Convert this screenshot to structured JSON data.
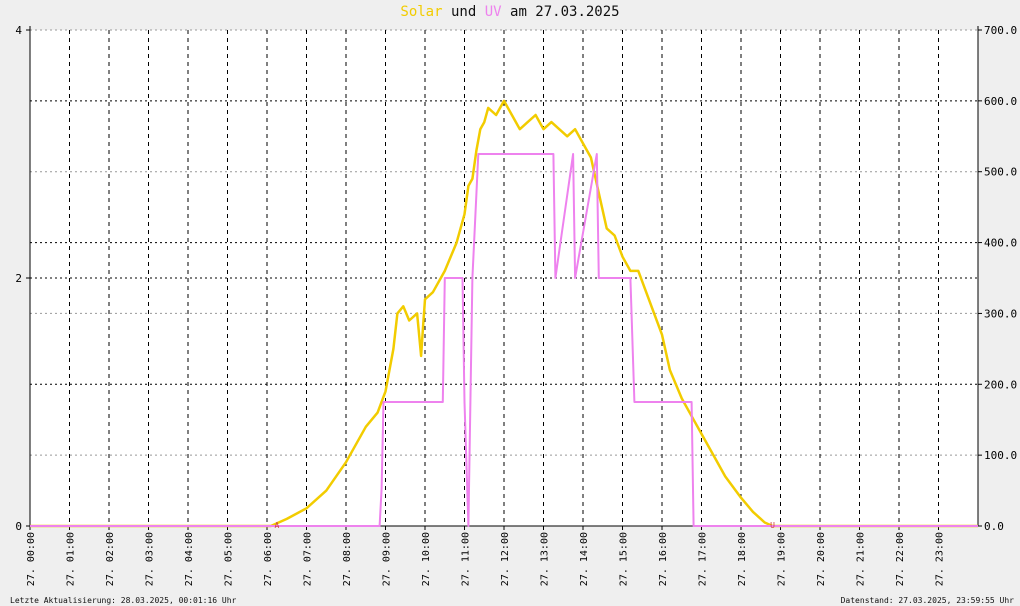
{
  "title": {
    "solar": "Solar",
    "und": "und",
    "uv": "UV",
    "rest": "am 27.03.2025"
  },
  "footer": {
    "left": "Letzte Aktualisierung: 28.03.2025, 00:01:16 Uhr",
    "right": "Datenstand: 27.03.2025, 23:59:55 Uhr"
  },
  "colors": {
    "solar": "#f2cc00",
    "uv": "#ee82ee",
    "background": "#efefef",
    "grid": "#000000"
  },
  "chart_data": {
    "type": "line",
    "title": "Solar und UV am 27.03.2025",
    "x_unit": "hours",
    "xlim": [
      0,
      24
    ],
    "x_ticks": [
      "27. 00:00",
      "27. 01:00",
      "27. 02:00",
      "27. 03:00",
      "27. 04:00",
      "27. 05:00",
      "27. 06:00",
      "27. 07:00",
      "27. 08:00",
      "27. 09:00",
      "27. 10:00",
      "27. 11:00",
      "27. 12:00",
      "27. 13:00",
      "27. 14:00",
      "27. 15:00",
      "27. 16:00",
      "27. 17:00",
      "27. 18:00",
      "27. 19:00",
      "27. 20:00",
      "27. 21:00",
      "27. 22:00",
      "27. 23:00"
    ],
    "y_left": {
      "ylim": [
        0,
        4
      ],
      "ticks": [
        "0",
        "2",
        "4"
      ]
    },
    "y_right": {
      "ylim": [
        0,
        700
      ],
      "ticks": [
        "0.0",
        "100.0",
        "200.0",
        "300.0",
        "400.0",
        "500.0",
        "600.0",
        "700.0"
      ]
    },
    "grid": true,
    "markers": [
      "A",
      "U"
    ],
    "series": [
      {
        "name": "Solar",
        "axis": "right",
        "x": [
          0,
          6.1,
          6.5,
          7.0,
          7.5,
          8.0,
          8.5,
          8.8,
          9.0,
          9.2,
          9.3,
          9.45,
          9.6,
          9.8,
          9.9,
          9.95,
          10.0,
          10.2,
          10.5,
          10.8,
          11.0,
          11.1,
          11.2,
          11.3,
          11.4,
          11.5,
          11.6,
          11.8,
          12.0,
          12.2,
          12.4,
          12.6,
          12.8,
          13.0,
          13.2,
          13.4,
          13.6,
          13.8,
          14.0,
          14.2,
          14.4,
          14.6,
          14.8,
          15.0,
          15.2,
          15.4,
          15.6,
          15.8,
          16.0,
          16.2,
          16.5,
          16.8,
          17.0,
          17.3,
          17.6,
          18.0,
          18.3,
          18.6,
          18.8,
          24
        ],
        "y": [
          0,
          0,
          10,
          25,
          50,
          90,
          140,
          160,
          190,
          250,
          300,
          310,
          290,
          300,
          240,
          280,
          320,
          330,
          360,
          400,
          440,
          480,
          490,
          530,
          560,
          570,
          590,
          580,
          600,
          580,
          560,
          570,
          580,
          560,
          570,
          560,
          550,
          560,
          540,
          520,
          470,
          420,
          410,
          380,
          360,
          360,
          330,
          300,
          270,
          220,
          180,
          150,
          130,
          100,
          70,
          40,
          20,
          5,
          0,
          0
        ]
      },
      {
        "name": "UV",
        "axis": "left",
        "x": [
          0,
          8.85,
          8.9,
          8.95,
          10.45,
          10.5,
          10.95,
          11.0,
          11.1,
          11.2,
          11.35,
          11.5,
          13.25,
          13.3,
          13.75,
          13.8,
          14.35,
          14.4,
          15.2,
          15.3,
          15.35,
          16.75,
          16.8,
          18.8,
          24
        ],
        "y": [
          0,
          0,
          0.3,
          1,
          1,
          2,
          2,
          1,
          0,
          2,
          3,
          3,
          3,
          2,
          3,
          2,
          3,
          2,
          2,
          1,
          1,
          1,
          0,
          0,
          0
        ]
      }
    ]
  }
}
